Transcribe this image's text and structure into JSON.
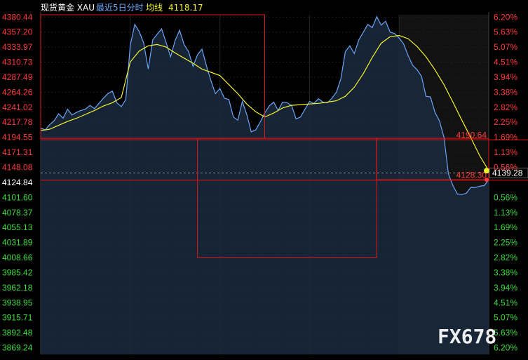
{
  "header": {
    "symbol": "现货黄金 XAU",
    "period": "最近5日分时",
    "ma_label": "均线",
    "ma_value": "4118.17"
  },
  "watermark": "FX678",
  "colors": {
    "background": "#000000",
    "price_line": "#6aa6f8",
    "avg_line": "#f2f22e",
    "up": "#ff3a3a",
    "down": "#3ddc3d",
    "box": "#e01818",
    "area_fill": "#1b2a3e"
  },
  "chart_data": {
    "type": "line",
    "title": "现货黄金 XAU 最近5日分时",
    "ylim": [
      3859.0,
      4384.0
    ],
    "reference_price": 4124.95,
    "left_ticks": [
      "4380.44",
      "4357.20",
      "4333.97",
      "4310.73",
      "4287.49",
      "4264.26",
      "4241.02",
      "4217.78",
      "4194.55",
      "4171.31",
      "4148.08",
      "4124.84",
      "4101.60",
      "4078.37",
      "4055.13",
      "4031.89",
      "4008.66",
      "3985.42",
      "3962.18",
      "3938.95",
      "3915.71",
      "3892.48",
      "3869.24"
    ],
    "left_tick_values": [
      4380.44,
      4357.2,
      4333.97,
      4310.73,
      4287.49,
      4264.26,
      4241.02,
      4217.78,
      4194.55,
      4171.31,
      4148.08,
      4124.84,
      4101.6,
      4078.37,
      4055.13,
      4031.89,
      4008.66,
      3985.42,
      3962.18,
      3938.95,
      3915.71,
      3892.48,
      3869.24
    ],
    "right_ticks": [
      "6.20%",
      "5.63%",
      "5.07%",
      "4.51%",
      "3.94%",
      "3.38%",
      "2.82%",
      "2.25%",
      "1.69%",
      "1.13%",
      "0.56%",
      "0.56%",
      "1.13%",
      "1.69%",
      "2.25%",
      "2.82%",
      "3.38%",
      "3.94%",
      "4.51%",
      "5.07%",
      "5.63%",
      "6.20%"
    ],
    "right_tick_values": [
      4380.44,
      4357.2,
      4333.97,
      4310.73,
      4287.49,
      4264.26,
      4241.02,
      4217.78,
      4194.55,
      4171.31,
      4148.08,
      4101.6,
      4078.37,
      4055.13,
      4031.89,
      4008.66,
      3985.42,
      3962.18,
      3938.95,
      3915.71,
      3892.48,
      3869.24
    ],
    "session_dividers": [
      0.5
    ],
    "session_count": 5,
    "series": [
      {
        "name": "price",
        "x": [
          0,
          0.01,
          0.02,
          0.03,
          0.04,
          0.05,
          0.06,
          0.07,
          0.08,
          0.09,
          0.1,
          0.11,
          0.12,
          0.13,
          0.14,
          0.15,
          0.16,
          0.17,
          0.18,
          0.19,
          0.2,
          0.21,
          0.22,
          0.23,
          0.24,
          0.25,
          0.26,
          0.27,
          0.28,
          0.29,
          0.3,
          0.31,
          0.32,
          0.33,
          0.34,
          0.35,
          0.36,
          0.37,
          0.38,
          0.39,
          0.4,
          0.41,
          0.42,
          0.43,
          0.44,
          0.45,
          0.46,
          0.47,
          0.48,
          0.49,
          0.5,
          0.51,
          0.52,
          0.53,
          0.54,
          0.55,
          0.56,
          0.57,
          0.58,
          0.59,
          0.6,
          0.61,
          0.62,
          0.63,
          0.64,
          0.65,
          0.66,
          0.67,
          0.68,
          0.69,
          0.7,
          0.71,
          0.72,
          0.73,
          0.74,
          0.75,
          0.76,
          0.77,
          0.78,
          0.79,
          0.8,
          0.81,
          0.82,
          0.83,
          0.84,
          0.85,
          0.86,
          0.87,
          0.88,
          0.89,
          0.9,
          0.91,
          0.92,
          0.93,
          0.94,
          0.95,
          0.96,
          0.97,
          0.98,
          0.99,
          1.0
        ],
        "values": [
          4209,
          4206,
          4214,
          4220,
          4231,
          4224,
          4238,
          4229,
          4233,
          4236,
          4238,
          4244,
          4239,
          4247,
          4255,
          4262,
          4266,
          4248,
          4242,
          4253,
          4337,
          4369,
          4358,
          4340,
          4300,
          4345,
          4354,
          4362,
          4341,
          4319,
          4344,
          4360,
          4338,
          4327,
          4304,
          4322,
          4331,
          4305,
          4282,
          4262,
          4270,
          4255,
          4253,
          4226,
          4221,
          4250,
          4230,
          4203,
          4206,
          4218,
          4232,
          4243,
          4249,
          4236,
          4249,
          4248,
          4244,
          4223,
          4226,
          4238,
          4250,
          4247,
          4254,
          4249,
          4248,
          4255,
          4264,
          4285,
          4327,
          4336,
          4324,
          4345,
          4357,
          4369,
          4364,
          4381,
          4368,
          4374,
          4357,
          4355,
          4348,
          4339,
          4321,
          4306,
          4299,
          4289,
          4258,
          4257,
          4233,
          4220,
          4195,
          4138,
          4120,
          4107,
          4106,
          4108,
          4117,
          4117,
          4119,
          4120,
          4129
        ]
      },
      {
        "name": "average",
        "x": [
          0,
          0.02,
          0.04,
          0.06,
          0.08,
          0.1,
          0.12,
          0.14,
          0.16,
          0.18,
          0.2,
          0.22,
          0.24,
          0.26,
          0.28,
          0.3,
          0.32,
          0.34,
          0.36,
          0.38,
          0.4,
          0.42,
          0.44,
          0.46,
          0.48,
          0.5,
          0.52,
          0.54,
          0.56,
          0.58,
          0.6,
          0.62,
          0.64,
          0.66,
          0.68,
          0.7,
          0.72,
          0.74,
          0.76,
          0.78,
          0.8,
          0.82,
          0.84,
          0.86,
          0.88,
          0.9,
          0.92,
          0.94,
          0.96,
          0.98,
          1.0
        ],
        "values": [
          4205,
          4207,
          4213,
          4219,
          4224,
          4230,
          4236,
          4243,
          4248,
          4256,
          4311,
          4328,
          4336,
          4338,
          4334,
          4325,
          4317,
          4309,
          4300,
          4295,
          4290,
          4276,
          4262,
          4246,
          4234,
          4226,
          4232,
          4240,
          4244,
          4245,
          4246,
          4247,
          4249,
          4251,
          4258,
          4272,
          4293,
          4318,
          4340,
          4350,
          4352,
          4347,
          4335,
          4319,
          4299,
          4276,
          4249,
          4221,
          4194,
          4166,
          4143
        ]
      }
    ],
    "boxes": [
      {
        "x0": 0.0,
        "x1": 0.5,
        "y_top": 4384.0,
        "y_bottom": 4193.0
      },
      {
        "x0": 0.35,
        "x1": 0.75,
        "y_top": 4193.0,
        "y_bottom": 4009.0
      },
      {
        "x0": 0.75,
        "x1": 1.0,
        "y_top": 4193.0,
        "y_bottom": 4129.0
      }
    ],
    "level_labels": [
      {
        "text": "4190.64",
        "value": 4190.64
      },
      {
        "text": "4128.30",
        "value": 4128.3
      }
    ],
    "current_price_label": {
      "text": "4139.28",
      "value": 4139.28
    }
  }
}
